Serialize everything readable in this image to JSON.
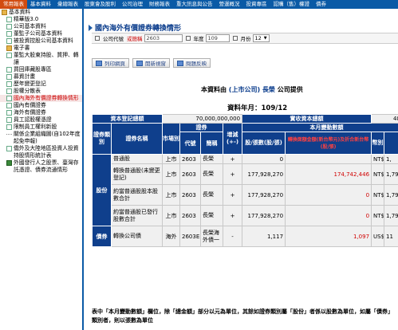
{
  "topnav": [
    "常用報表",
    "基本資料",
    "彙總報表",
    "股東會及股利",
    "公司治理",
    "財務報表",
    "重大訊息與公告",
    "營運概況",
    "投資專區",
    "認購（售）權證",
    "債券"
  ],
  "sidebar": [
    {
      "label": "基本資料",
      "lvl": 1,
      "icon": "folder"
    },
    {
      "label": "精華版3.0",
      "lvl": 2,
      "icon": "doc"
    },
    {
      "label": "公司基本資料",
      "lvl": 2,
      "icon": "doc"
    },
    {
      "label": "董監子公司基本資料",
      "lvl": 2,
      "icon": "doc"
    },
    {
      "label": "被投資控股公司基本資料",
      "lvl": 2,
      "icon": "doc"
    },
    {
      "label": "電子書",
      "lvl": 2,
      "icon": "folder"
    },
    {
      "label": "董監大股東持股、質押、轉讓",
      "lvl": 2,
      "icon": "doc"
    },
    {
      "label": "買回庫藏股專區",
      "lvl": 2,
      "icon": "doc"
    },
    {
      "label": "募資計畫",
      "lvl": 2,
      "icon": "doc"
    },
    {
      "label": "歷年變更登記",
      "lvl": 2,
      "icon": "doc"
    },
    {
      "label": "股權分散表",
      "lvl": 2,
      "icon": "doc"
    },
    {
      "label": "國內海外有價證券轉換情形",
      "lvl": 2,
      "icon": "doc",
      "selected": true
    },
    {
      "label": "國內有價證券",
      "lvl": 2,
      "icon": "doc"
    },
    {
      "label": "海外有價證券",
      "lvl": 2,
      "icon": "doc"
    },
    {
      "label": "員工認股權憑證",
      "lvl": 2,
      "icon": "doc"
    },
    {
      "label": "限制員工權利新股",
      "lvl": 2,
      "icon": "doc"
    },
    {
      "label": "關係企業組織圖(自102年度起免申報)",
      "lvl": 2,
      "icon": "dash"
    },
    {
      "label": "僑外及大陸地區投資人投資持股情形統計表",
      "lvl": 2,
      "icon": "doc"
    },
    {
      "label": "外國發行人之股票、臺灣存託憑證、債券流通情形",
      "lvl": 2,
      "icon": "book"
    }
  ],
  "page": {
    "title": "國內海外有價證券轉換情形",
    "query": {
      "code_label": "公司代號",
      "code_link": "或簡稱",
      "code_value": "2603",
      "year_label": "年度",
      "year_value": "109",
      "month_label": "月份",
      "month_value": "12"
    },
    "buttons": [
      "列印網頁",
      "開新視窗",
      "問題反映"
    ],
    "provider_prefix": "本資料由",
    "provider_company": "(上市公司) 長榮",
    "provider_suffix": "公司提供",
    "period_label": "資料年月：109/12"
  },
  "table": {
    "top": {
      "reg_capital_label": "資本登記總額",
      "reg_capital_value": "70,000,000,000",
      "paid_capital_label": "實收資本總額",
      "paid_capital_value": "48,12"
    },
    "headers": {
      "category": "證券類別",
      "name": "證券名稱",
      "market": "市場別",
      "securities": "證券",
      "code": "代號",
      "abbr": "簡稱",
      "change": "增減(+-)",
      "shares": "股/張數(股/張)",
      "month_change": "本月變動數額",
      "conv_amount": "轉換面額金額(新台幣元)及折合新台幣(股/張)",
      "currency": "幣別"
    },
    "rows": [
      {
        "cat": "",
        "name": "普通股",
        "market": "上市",
        "code": "2603",
        "abbr": "長榮",
        "change": "+",
        "shares": "0",
        "amount": "",
        "cur": "NT$",
        "tail": "1,"
      },
      {
        "cat": "",
        "name": "轉換普通股(未變更登記)",
        "market": "上市",
        "code": "2603",
        "abbr": "長榮",
        "change": "+",
        "shares": "177,928,270",
        "amount": "174,742,446",
        "cur": "NT$",
        "tail": "1,79"
      },
      {
        "cat": "股份",
        "name": "約當普通股股本股數合計",
        "market": "上市",
        "code": "2603",
        "abbr": "長榮",
        "change": "+",
        "shares": "177,928,270",
        "amount": "0",
        "cur": "NT$",
        "tail": "1,79"
      },
      {
        "cat": "",
        "name": "約當普通股已發行股數合計",
        "market": "上市",
        "code": "2603",
        "abbr": "長榮",
        "change": "+",
        "shares": "177,928,270",
        "amount": "0",
        "cur": "NT$",
        "tail": "1,79"
      },
      {
        "cat": "債券",
        "name": "轉換公司債",
        "market": "海外",
        "code": "2603E1",
        "abbr": "長榮海外債一",
        "change": "-",
        "shares": "1,117",
        "amount": "1,097",
        "cur": "US$",
        "tail": "11"
      }
    ]
  },
  "footnote": "表中「本月變動數額」欄位，除「總金額」部分以元為單位，其餘如證券類別屬「股份」者係以股數為單位，如屬「債券」類別者，則以張數為單位",
  "colors": {
    "nav_blue": "#0a5aa6",
    "table_header": "#0f3f8c",
    "red": "#d00000",
    "active_tab": "#d24c10"
  }
}
